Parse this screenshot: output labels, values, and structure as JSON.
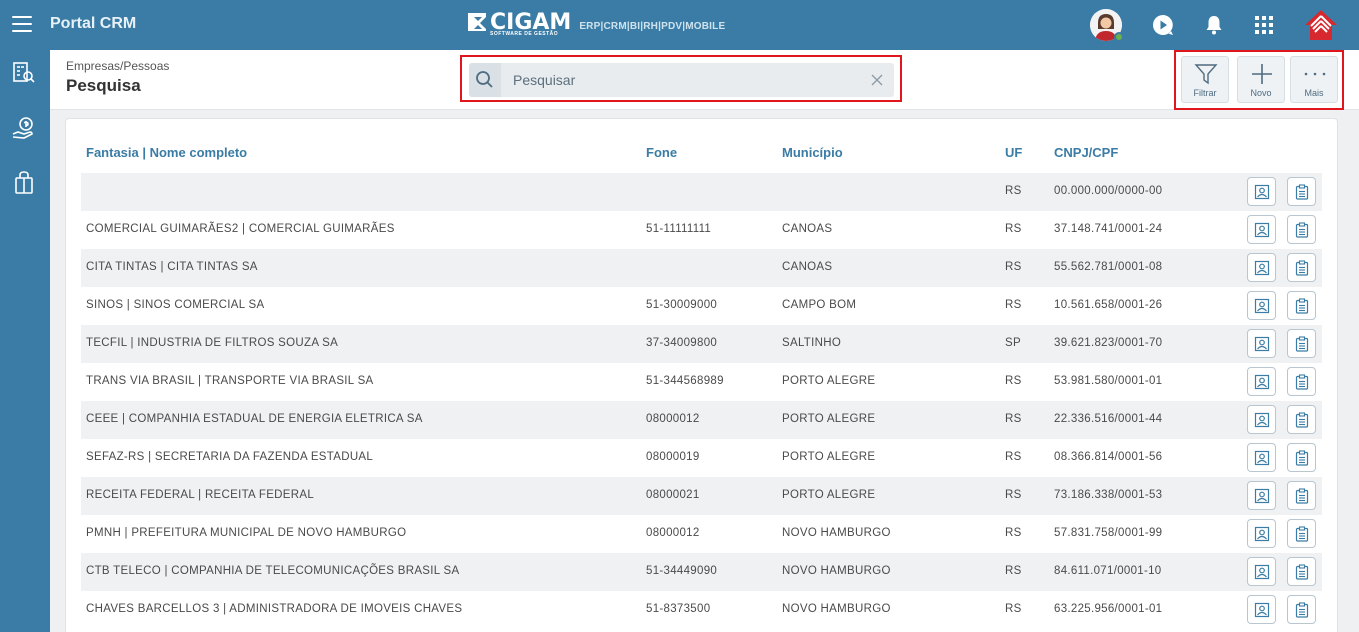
{
  "app": {
    "title": "Portal CRM"
  },
  "brand": {
    "name": "CIGAM",
    "tagline": "SOFTWARE DE GESTÃO",
    "modules": "ERP|CRM|BI|RH|PDV|MOBILE"
  },
  "header": {
    "breadcrumb": "Empresas/Pessoas",
    "title": "Pesquisa"
  },
  "search": {
    "placeholder": "Pesquisar",
    "value": ""
  },
  "toolbar": {
    "filter_label": "Filtrar",
    "new_label": "Novo",
    "more_label": "Mais"
  },
  "colors": {
    "primary": "#3a7ca5",
    "highlight": "#e0161d",
    "row_alt": "#f0f1f2"
  },
  "table": {
    "columns": {
      "name": "Fantasia | Nome completo",
      "phone": "Fone",
      "city": "Município",
      "uf": "UF",
      "doc": "CNPJ/CPF"
    },
    "rows": [
      {
        "name": "",
        "phone": "",
        "city": "",
        "uf": "RS",
        "doc": "00.000.000/0000-00"
      },
      {
        "name": "COMERCIAL GUIMARÃES2 | COMERCIAL GUIMARÃES",
        "phone": "51-11111111",
        "city": "CANOAS",
        "uf": "RS",
        "doc": "37.148.741/0001-24"
      },
      {
        "name": "CITA TINTAS | CITA TINTAS SA",
        "phone": "",
        "city": "CANOAS",
        "uf": "RS",
        "doc": "55.562.781/0001-08"
      },
      {
        "name": "SINOS | SINOS COMERCIAL SA",
        "phone": "51-30009000",
        "city": "CAMPO BOM",
        "uf": "RS",
        "doc": "10.561.658/0001-26"
      },
      {
        "name": "TECFIL | INDUSTRIA DE FILTROS SOUZA SA",
        "phone": "37-34009800",
        "city": "SALTINHO",
        "uf": "SP",
        "doc": "39.621.823/0001-70"
      },
      {
        "name": "TRANS VIA BRASIL | TRANSPORTE VIA BRASIL SA",
        "phone": "51-344568989",
        "city": "PORTO ALEGRE",
        "uf": "RS",
        "doc": "53.981.580/0001-01"
      },
      {
        "name": "CEEE | COMPANHIA ESTADUAL DE ENERGIA ELETRICA SA",
        "phone": "08000012",
        "city": "PORTO ALEGRE",
        "uf": "RS",
        "doc": "22.336.516/0001-44"
      },
      {
        "name": "SEFAZ-RS | SECRETARIA DA FAZENDA ESTADUAL",
        "phone": "08000019",
        "city": "PORTO ALEGRE",
        "uf": "RS",
        "doc": "08.366.814/0001-56"
      },
      {
        "name": "RECEITA FEDERAL | RECEITA FEDERAL",
        "phone": "08000021",
        "city": "PORTO ALEGRE",
        "uf": "RS",
        "doc": "73.186.338/0001-53"
      },
      {
        "name": "PMNH | PREFEITURA MUNICIPAL DE NOVO HAMBURGO",
        "phone": "08000012",
        "city": "NOVO HAMBURGO",
        "uf": "RS",
        "doc": "57.831.758/0001-99"
      },
      {
        "name": "CTB TELECO | COMPANHIA DE TELECOMUNICAÇÕES BRASIL SA",
        "phone": "51-34449090",
        "city": "NOVO HAMBURGO",
        "uf": "RS",
        "doc": "84.611.071/0001-10"
      },
      {
        "name": "CHAVES BARCELLOS 3 | ADMINISTRADORA DE IMOVEIS CHAVES",
        "phone": "51-8373500",
        "city": "NOVO HAMBURGO",
        "uf": "RS",
        "doc": "63.225.956/0001-01"
      }
    ]
  }
}
